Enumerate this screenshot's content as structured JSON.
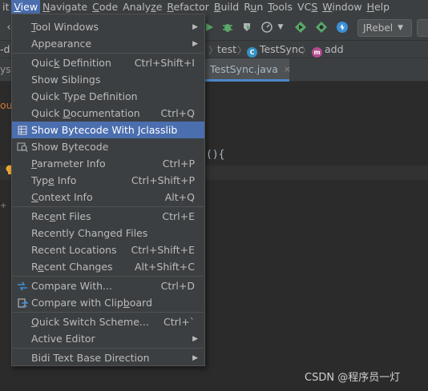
{
  "menubar": {
    "items": [
      {
        "label": "it",
        "u": "",
        "rest": ""
      },
      {
        "label": "",
        "u": "V",
        "rest": "iew"
      },
      {
        "label": "",
        "u": "N",
        "rest": "avigate"
      },
      {
        "label": "",
        "u": "C",
        "rest": "ode"
      },
      {
        "label": "Analy",
        "u": "z",
        "rest": "e"
      },
      {
        "label": "",
        "u": "R",
        "rest": "efactor"
      },
      {
        "label": "",
        "u": "B",
        "rest": "uild"
      },
      {
        "label": "R",
        "u": "u",
        "rest": "n"
      },
      {
        "label": "",
        "u": "T",
        "rest": "ools"
      },
      {
        "label": "VC",
        "u": "S",
        "rest": ""
      },
      {
        "label": "",
        "u": "W",
        "rest": "indow"
      },
      {
        "label": "",
        "u": "H",
        "rest": "elp"
      }
    ]
  },
  "toolbar": {
    "jrebel_label": "JRebel"
  },
  "breadcrumb": {
    "left_fragment": "-d",
    "item1": "test",
    "item2": "TestSync",
    "item3": "add",
    "item2_badge": "C",
    "item3_badge": "m"
  },
  "tabs": {
    "left_fragment": "ys",
    "active_label": "TestSync.java",
    "close": "×"
  },
  "editor": {
    "left_fragment": "ou",
    "code_fragment": "(){"
  },
  "watermark": "CSDN @程序员一灯",
  "view_menu": {
    "items": [
      {
        "pre": "",
        "u": "T",
        "post": "ool Windows",
        "shortcut": "",
        "submenu": true,
        "icon": ""
      },
      {
        "pre": "",
        "u": "",
        "post": "Appearance",
        "shortcut": "",
        "submenu": true,
        "icon": ""
      },
      {
        "pre": "Quic",
        "u": "k",
        "post": " Definition",
        "shortcut": "Ctrl+Shift+I",
        "submenu": false,
        "icon": ""
      },
      {
        "pre": "Show Siblings",
        "u": "",
        "post": "",
        "shortcut": "",
        "submenu": false,
        "icon": ""
      },
      {
        "pre": "Quick Type Definition",
        "u": "",
        "post": "",
        "shortcut": "",
        "submenu": false,
        "icon": ""
      },
      {
        "pre": "Quick ",
        "u": "D",
        "post": "ocumentation",
        "shortcut": "Ctrl+Q",
        "submenu": false,
        "icon": ""
      },
      {
        "pre": "Show Bytecode With Jclasslib",
        "u": "",
        "post": "",
        "shortcut": "",
        "submenu": false,
        "icon": "bytecode-grid-icon"
      },
      {
        "pre": "Show Bytecode",
        "u": "",
        "post": "",
        "shortcut": "",
        "submenu": false,
        "icon": "bytecode-search-icon"
      },
      {
        "pre": "",
        "u": "P",
        "post": "arameter Info",
        "shortcut": "Ctrl+P",
        "submenu": false,
        "icon": ""
      },
      {
        "pre": "Typ",
        "u": "e",
        "post": " Info",
        "shortcut": "Ctrl+Shift+P",
        "submenu": false,
        "icon": ""
      },
      {
        "pre": "",
        "u": "C",
        "post": "ontext Info",
        "shortcut": "Alt+Q",
        "submenu": false,
        "icon": ""
      },
      {
        "pre": "Rec",
        "u": "e",
        "post": "nt Files",
        "shortcut": "Ctrl+E",
        "submenu": false,
        "icon": ""
      },
      {
        "pre": "Recently Changed Files",
        "u": "",
        "post": "",
        "shortcut": "",
        "submenu": false,
        "icon": ""
      },
      {
        "pre": "Recent Locations",
        "u": "",
        "post": "",
        "shortcut": "Ctrl+Shift+E",
        "submenu": false,
        "icon": ""
      },
      {
        "pre": "R",
        "u": "e",
        "post": "cent Changes",
        "shortcut": "Alt+Shift+C",
        "submenu": false,
        "icon": ""
      },
      {
        "pre": "Compare With...",
        "u": "",
        "post": "",
        "shortcut": "Ctrl+D",
        "submenu": false,
        "icon": "compare-icon"
      },
      {
        "pre": "Compare with Clip",
        "u": "b",
        "post": "oard",
        "shortcut": "",
        "submenu": false,
        "icon": "compare-clipboard-icon"
      },
      {
        "pre": "",
        "u": "Q",
        "post": "uick Switch Scheme...",
        "shortcut": "Ctrl+`",
        "submenu": false,
        "icon": ""
      },
      {
        "pre": "Active Editor",
        "u": "",
        "post": "",
        "shortcut": "",
        "submenu": true,
        "icon": ""
      },
      {
        "pre": "Bidi Text Base Direction",
        "u": "",
        "post": "",
        "shortcut": "",
        "submenu": true,
        "icon": ""
      }
    ],
    "selected_index": 6
  },
  "colors": {
    "menu_bg": "#3c3f41",
    "selection": "#4b6eaf",
    "editor_bg": "#2b2b2b"
  }
}
